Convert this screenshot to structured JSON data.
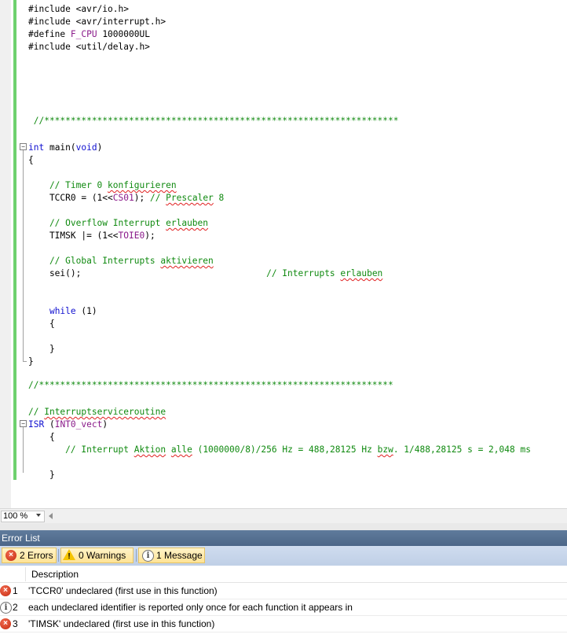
{
  "editor": {
    "lines": [
      {
        "segments": [
          {
            "t": "#include <avr/io.h>",
            "c": ""
          }
        ]
      },
      {
        "segments": [
          {
            "t": "#include <avr/interrupt.h>",
            "c": ""
          }
        ]
      },
      {
        "segments": [
          {
            "t": "#define ",
            "c": ""
          },
          {
            "t": "F_CPU",
            "c": "mac"
          },
          {
            "t": " 1000000UL",
            "c": ""
          }
        ]
      },
      {
        "segments": [
          {
            "t": "#include <util/delay.h>",
            "c": ""
          }
        ]
      },
      {
        "segments": [
          {
            "t": " //*******************************************************************",
            "c": "cm"
          }
        ]
      },
      {
        "segments": [
          {
            "t": "int",
            "c": "kw"
          },
          {
            "t": " main(",
            "c": ""
          },
          {
            "t": "void",
            "c": "kw"
          },
          {
            "t": ")",
            "c": ""
          }
        ]
      },
      {
        "segments": [
          {
            "t": "{",
            "c": ""
          }
        ]
      },
      {
        "segments": [
          {
            "t": "    // Timer 0 ",
            "c": "cm"
          },
          {
            "t": "konfigurieren",
            "c": "cm sq"
          }
        ]
      },
      {
        "segments": [
          {
            "t": "    TCCR0 = (1<<",
            "c": ""
          },
          {
            "t": "CS01",
            "c": "mac"
          },
          {
            "t": "); ",
            "c": ""
          },
          {
            "t": "// ",
            "c": "cm"
          },
          {
            "t": "Prescaler",
            "c": "cm sq"
          },
          {
            "t": " 8",
            "c": "cm"
          }
        ]
      },
      {
        "segments": [
          {
            "t": "    // Overflow Interrupt ",
            "c": "cm"
          },
          {
            "t": "erlauben",
            "c": "cm sq"
          }
        ]
      },
      {
        "segments": [
          {
            "t": "    TIMSK |= (1<<",
            "c": ""
          },
          {
            "t": "TOIE0",
            "c": "mac"
          },
          {
            "t": ");",
            "c": ""
          }
        ]
      },
      {
        "segments": [
          {
            "t": "    // Global Interrupts ",
            "c": "cm"
          },
          {
            "t": "aktivieren",
            "c": "cm sq"
          }
        ]
      },
      {
        "segments": [
          {
            "t": "    sei();",
            "c": ""
          },
          {
            "t": "                                   // Interrupts ",
            "c": "cm"
          },
          {
            "t": "erlauben",
            "c": "cm sq"
          }
        ]
      },
      {
        "segments": [
          {
            "t": "    ",
            "c": ""
          },
          {
            "t": "while",
            "c": "kw"
          },
          {
            "t": " (1)",
            "c": ""
          }
        ]
      },
      {
        "segments": [
          {
            "t": "    {",
            "c": ""
          }
        ]
      },
      {
        "segments": [
          {
            "t": "    }",
            "c": ""
          }
        ]
      },
      {
        "segments": [
          {
            "t": "}",
            "c": ""
          }
        ]
      },
      {
        "segments": [
          {
            "t": "//*******************************************************************",
            "c": "cm"
          }
        ]
      },
      {
        "segments": [
          {
            "t": "// ",
            "c": "cm"
          },
          {
            "t": "Interruptserviceroutine",
            "c": "cm sq"
          }
        ]
      },
      {
        "segments": [
          {
            "t": "ISR",
            "c": "kw"
          },
          {
            "t": " (",
            "c": ""
          },
          {
            "t": "INT0_vect",
            "c": "mac"
          },
          {
            "t": ")",
            "c": ""
          }
        ]
      },
      {
        "segments": [
          {
            "t": "    {",
            "c": ""
          }
        ]
      },
      {
        "segments": [
          {
            "t": "       // Interrupt ",
            "c": "cm"
          },
          {
            "t": "Aktion",
            "c": "cm sq"
          },
          {
            "t": " ",
            "c": "cm"
          },
          {
            "t": "alle",
            "c": "cm sq"
          },
          {
            "t": " (1000000/8)/256 Hz = 488,28125 Hz ",
            "c": "cm"
          },
          {
            "t": "bzw",
            "c": "cm sq"
          },
          {
            "t": ". 1/488,28125 s = 2,048 ms",
            "c": "cm"
          }
        ]
      },
      {
        "segments": [
          {
            "t": "    }",
            "c": ""
          }
        ]
      }
    ]
  },
  "zoom": {
    "value": "100 %"
  },
  "error_list": {
    "title": "Error List",
    "filters": {
      "errors": "2 Errors",
      "warnings": "0 Warnings",
      "messages": "1 Message"
    },
    "column_description": "Description",
    "rows": [
      {
        "num": "1",
        "type": "error",
        "desc": "'TCCR0' undeclared (first use in this function)"
      },
      {
        "num": "2",
        "type": "info",
        "desc": "each undeclared identifier is reported only once for each function it appears in"
      },
      {
        "num": "3",
        "type": "error",
        "desc": "'TIMSK' undeclared (first use in this function)"
      }
    ]
  }
}
